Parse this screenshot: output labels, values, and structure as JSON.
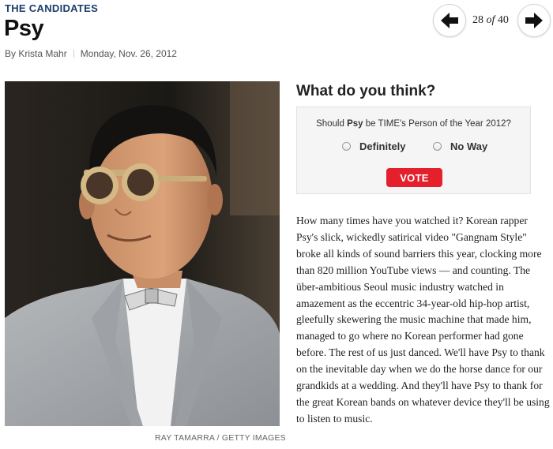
{
  "header": {
    "kicker": "THE CANDIDATES",
    "title": "Psy",
    "author": "By Krista Mahr",
    "date": "Monday, Nov. 26, 2012"
  },
  "gallery": {
    "current": "28",
    "of": "of",
    "total": "40",
    "prev_icon": "arrow-left-icon",
    "next_icon": "arrow-right-icon"
  },
  "photo": {
    "credit": "RAY TAMARRA / GETTY IMAGES"
  },
  "poll": {
    "heading": "What do you think?",
    "question_pre": "Should ",
    "question_name": "Psy",
    "question_post": " be TIME's Person of the Year 2012?",
    "options": [
      "Definitely",
      "No Way"
    ],
    "vote_label": "VOTE",
    "vote_color": "#e4202d"
  },
  "article": {
    "body": "How many times have you watched it? Korean rapper Psy's slick, wickedly satirical video \"Gangnam Style\" broke all kinds of sound barriers this year, clocking more than 820 million YouTube views — and counting. The über-ambitious Seoul music industry watched in amazement as the eccentric 34-year-old hip-hop artist, gleefully skewering the music machine that made him, managed to go where no Korean performer had gone before. The rest of us just danced. We'll have Psy to thank on the inevitable day when we do the horse dance for our grandkids at a wedding. And they'll have Psy to thank for the great Korean bands on whatever device they'll be using to listen to music."
  }
}
